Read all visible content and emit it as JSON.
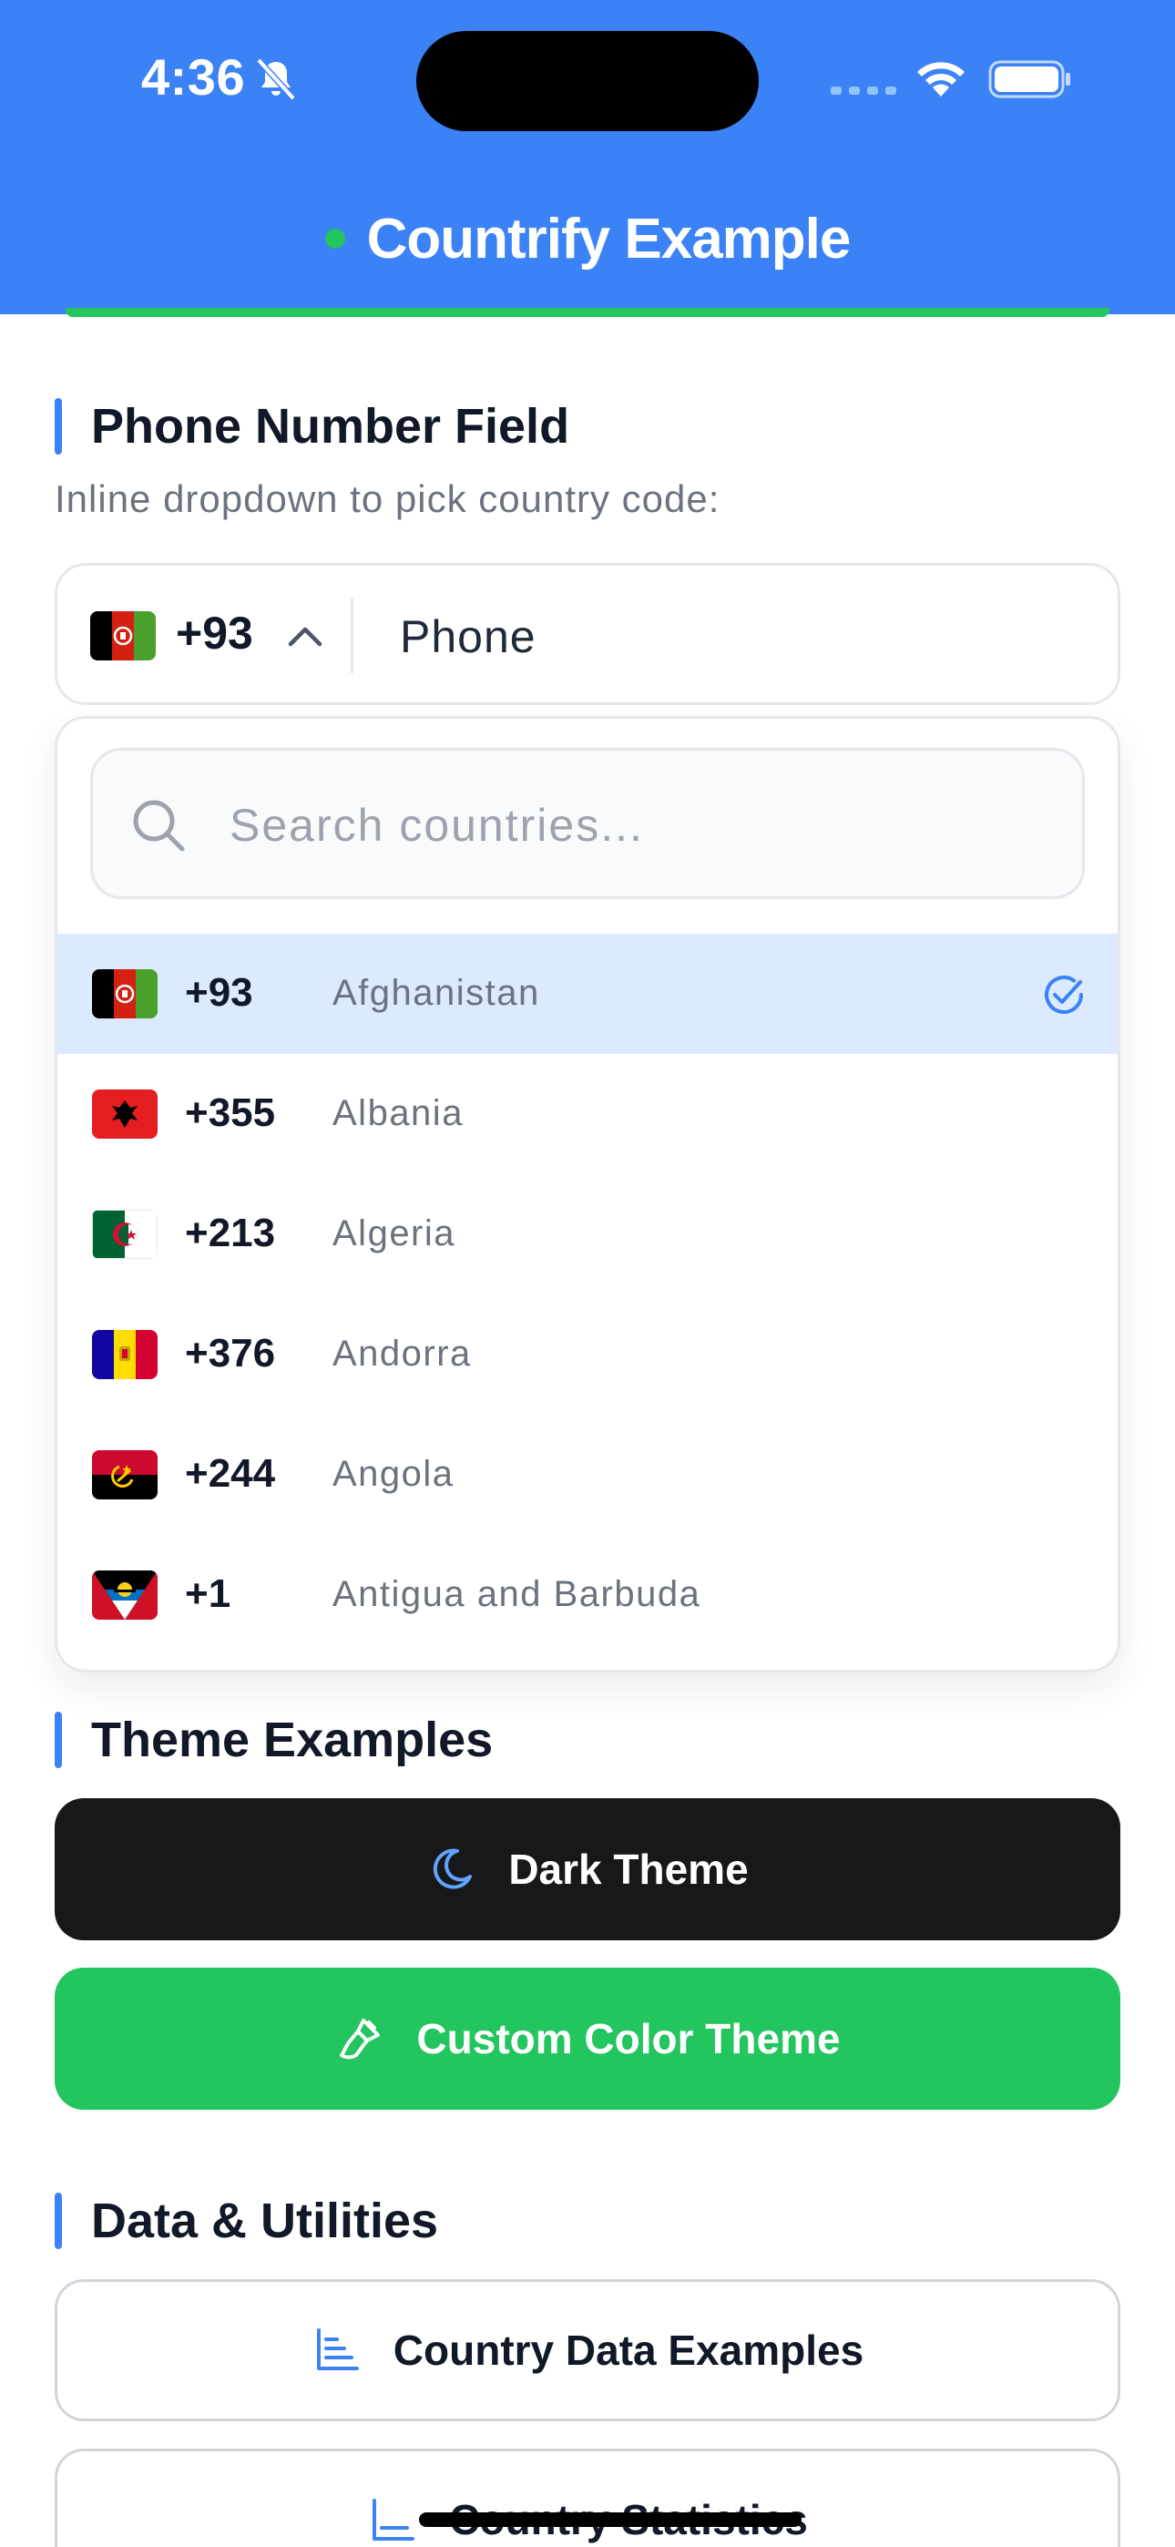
{
  "status_bar": {
    "time": "4:36"
  },
  "header": {
    "title": "Countrify Example",
    "accent": "#3b82f6",
    "dot_color": "#22c55e"
  },
  "phone_section": {
    "title": "Phone Number Field",
    "description": "Inline dropdown to pick country code:",
    "selected_code": "+93",
    "selected_flag": "flag-afghanistan",
    "phone_placeholder": "Phone",
    "search_placeholder": "Search countries...",
    "countries": [
      {
        "code": "+93",
        "name": "Afghanistan",
        "flag": "flag-afghanistan",
        "selected": true
      },
      {
        "code": "+355",
        "name": "Albania",
        "flag": "flag-albania",
        "selected": false
      },
      {
        "code": "+213",
        "name": "Algeria",
        "flag": "flag-algeria",
        "selected": false
      },
      {
        "code": "+376",
        "name": "Andorra",
        "flag": "flag-andorra",
        "selected": false
      },
      {
        "code": "+244",
        "name": "Angola",
        "flag": "flag-angola",
        "selected": false
      },
      {
        "code": "+1",
        "name": "Antigua and Barbuda",
        "flag": "flag-antigua",
        "selected": false
      }
    ]
  },
  "theme_section": {
    "title": "Theme Examples",
    "dark_label": "Dark Theme",
    "dark_icon": "moon-icon",
    "custom_label": "Custom Color Theme",
    "custom_icon": "brush-icon",
    "custom_color": "#22c55e"
  },
  "data_section": {
    "title": "Data & Utilities",
    "data_label": "Country Data Examples",
    "data_icon": "chart-icon",
    "stats_label": "Country Statistics",
    "stats_icon": "chart-icon"
  }
}
